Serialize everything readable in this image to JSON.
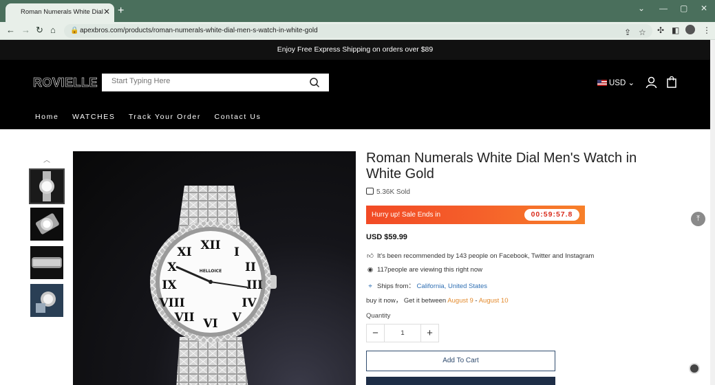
{
  "browser": {
    "tab_title": "Roman Numerals White Dial Men's Watch in White Gold",
    "tab_close": "✕",
    "new_tab": "+",
    "url": "apexbros.com/products/roman-numerals-white-dial-men-s-watch-in-white-gold"
  },
  "announcement": "Enjoy Free Express Shipping on orders over $89",
  "header": {
    "logo": "ROVIELLE",
    "search_placeholder": "Start Typing Here",
    "currency": "USD",
    "menu": [
      "Home",
      "WATCHES",
      "Track Your Order",
      "Contact Us"
    ]
  },
  "product": {
    "title": "Roman Numerals White Dial Men's Watch in White Gold",
    "sold": "5.36K Sold",
    "sale_label": "Hurry up! Sale Ends in",
    "timer": "00:59:57.8",
    "price": "USD $59.99",
    "recommended": "It's been recommended by 143 people on Facebook, Twitter and Instagram",
    "viewing": "117people are viewing this right now",
    "ships_from_label": "Ships from：",
    "ships_from_value": "California, United States",
    "delivery_prefix": "buy it now， Get it between",
    "delivery_start": "August 9",
    "delivery_sep": " - ",
    "delivery_end": "August 10",
    "quantity_label": "Quantity",
    "quantity_value": "1",
    "add_to_cart": "Add To Cart",
    "watch_brand": "HELLOICE"
  }
}
